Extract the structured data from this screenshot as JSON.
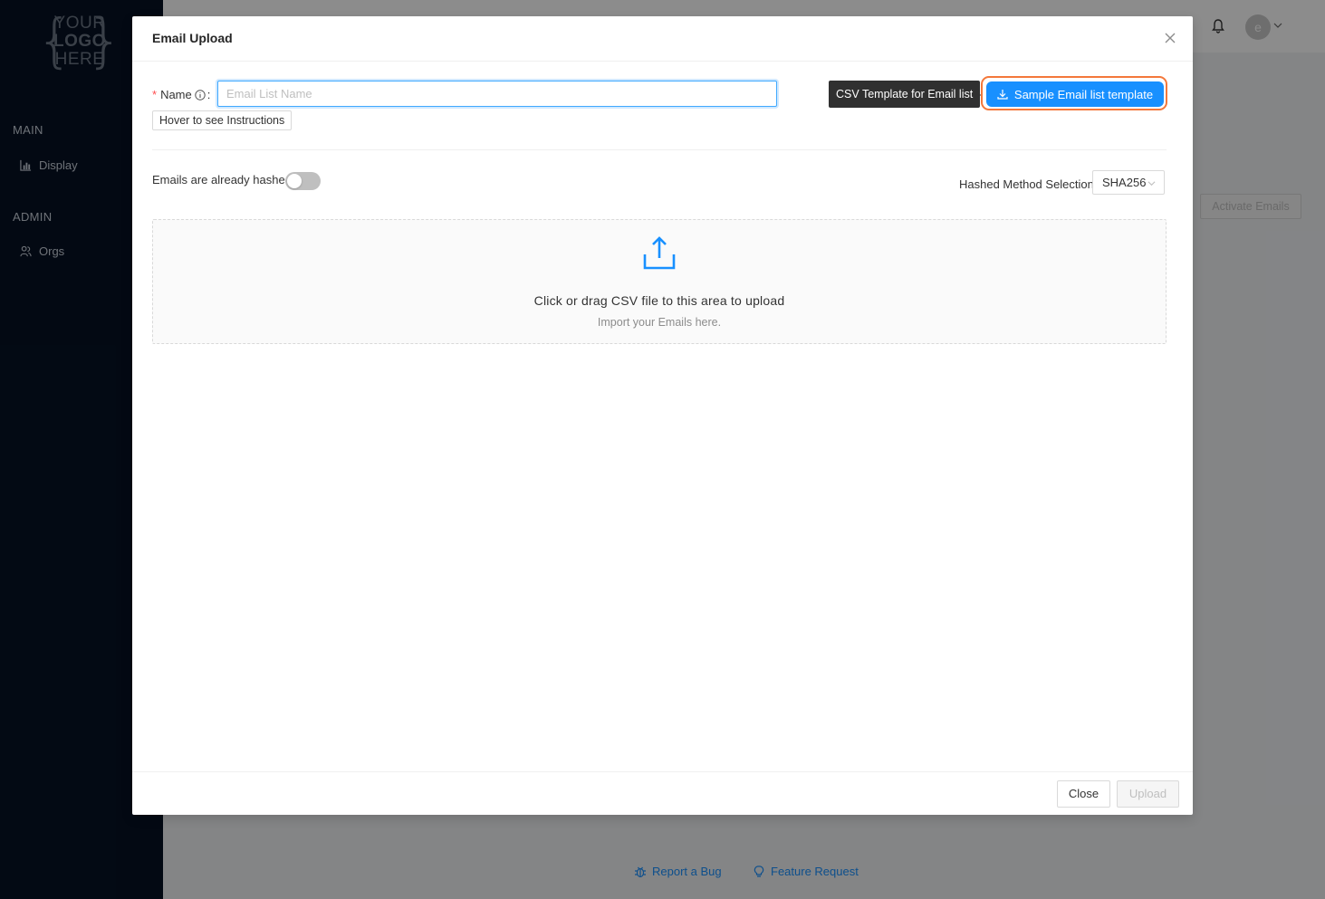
{
  "sidebar": {
    "logo": {
      "line1": "YOUR",
      "line2": "LOGO",
      "line3": "HERE"
    },
    "sections": [
      {
        "title": "MAIN",
        "items": [
          {
            "label": "Display",
            "icon": "chart-icon"
          }
        ]
      },
      {
        "title": "ADMIN",
        "items": [
          {
            "label": "Orgs",
            "icon": "users-icon"
          }
        ]
      }
    ]
  },
  "topbar": {
    "avatar_initial": "e"
  },
  "background": {
    "activate_label": "Activate Emails"
  },
  "footer": {
    "report_bug": "Report a Bug",
    "feature_request": "Feature Request"
  },
  "modal": {
    "title": "Email Upload",
    "name_label": "Name",
    "name_colon": ":",
    "name_placeholder": "Email List Name",
    "hover_instructions": "Hover to see Instructions",
    "tooltip": "CSV Template for Email list",
    "sample_button": "Sample Email list template",
    "hashed_label": "Emails are already hashed",
    "method_label": "Hashed Method Selection",
    "method_value": "SHA256",
    "dropzone_text": "Click or drag CSV file to this area to upload",
    "dropzone_hint": "Import your Emails here.",
    "close_button": "Close",
    "upload_button": "Upload"
  },
  "colors": {
    "primary": "#1890ff",
    "sidebar": "#061224",
    "highlight": "#f4783b"
  }
}
